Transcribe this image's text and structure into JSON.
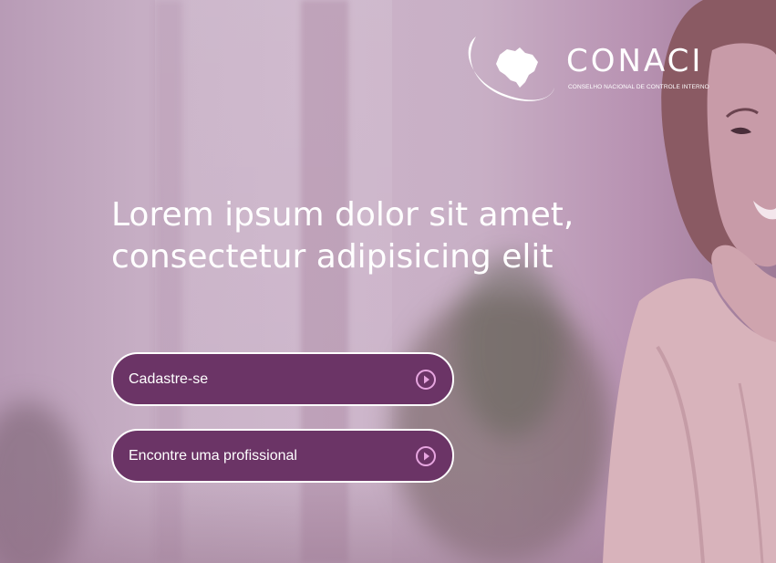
{
  "logo": {
    "wordmark": "CONACI",
    "tagline": "CONSELHO NACIONAL DE CONTROLE INTERNO",
    "icon": "brazil-map-icon"
  },
  "hero": {
    "headline_line1": "Lorem ipsum dolor sit amet,",
    "headline_line2": "consectetur adipisicing elit"
  },
  "actions": {
    "register_label": "Cadastre-se",
    "find_professional_label": "Encontre uma profissional",
    "arrow_icon": "play-circle-icon"
  },
  "colors": {
    "button_fill": "#6b3466",
    "button_border": "#ffffff",
    "icon_accent": "#e7a6e0",
    "overlay": "#c8afc5"
  }
}
